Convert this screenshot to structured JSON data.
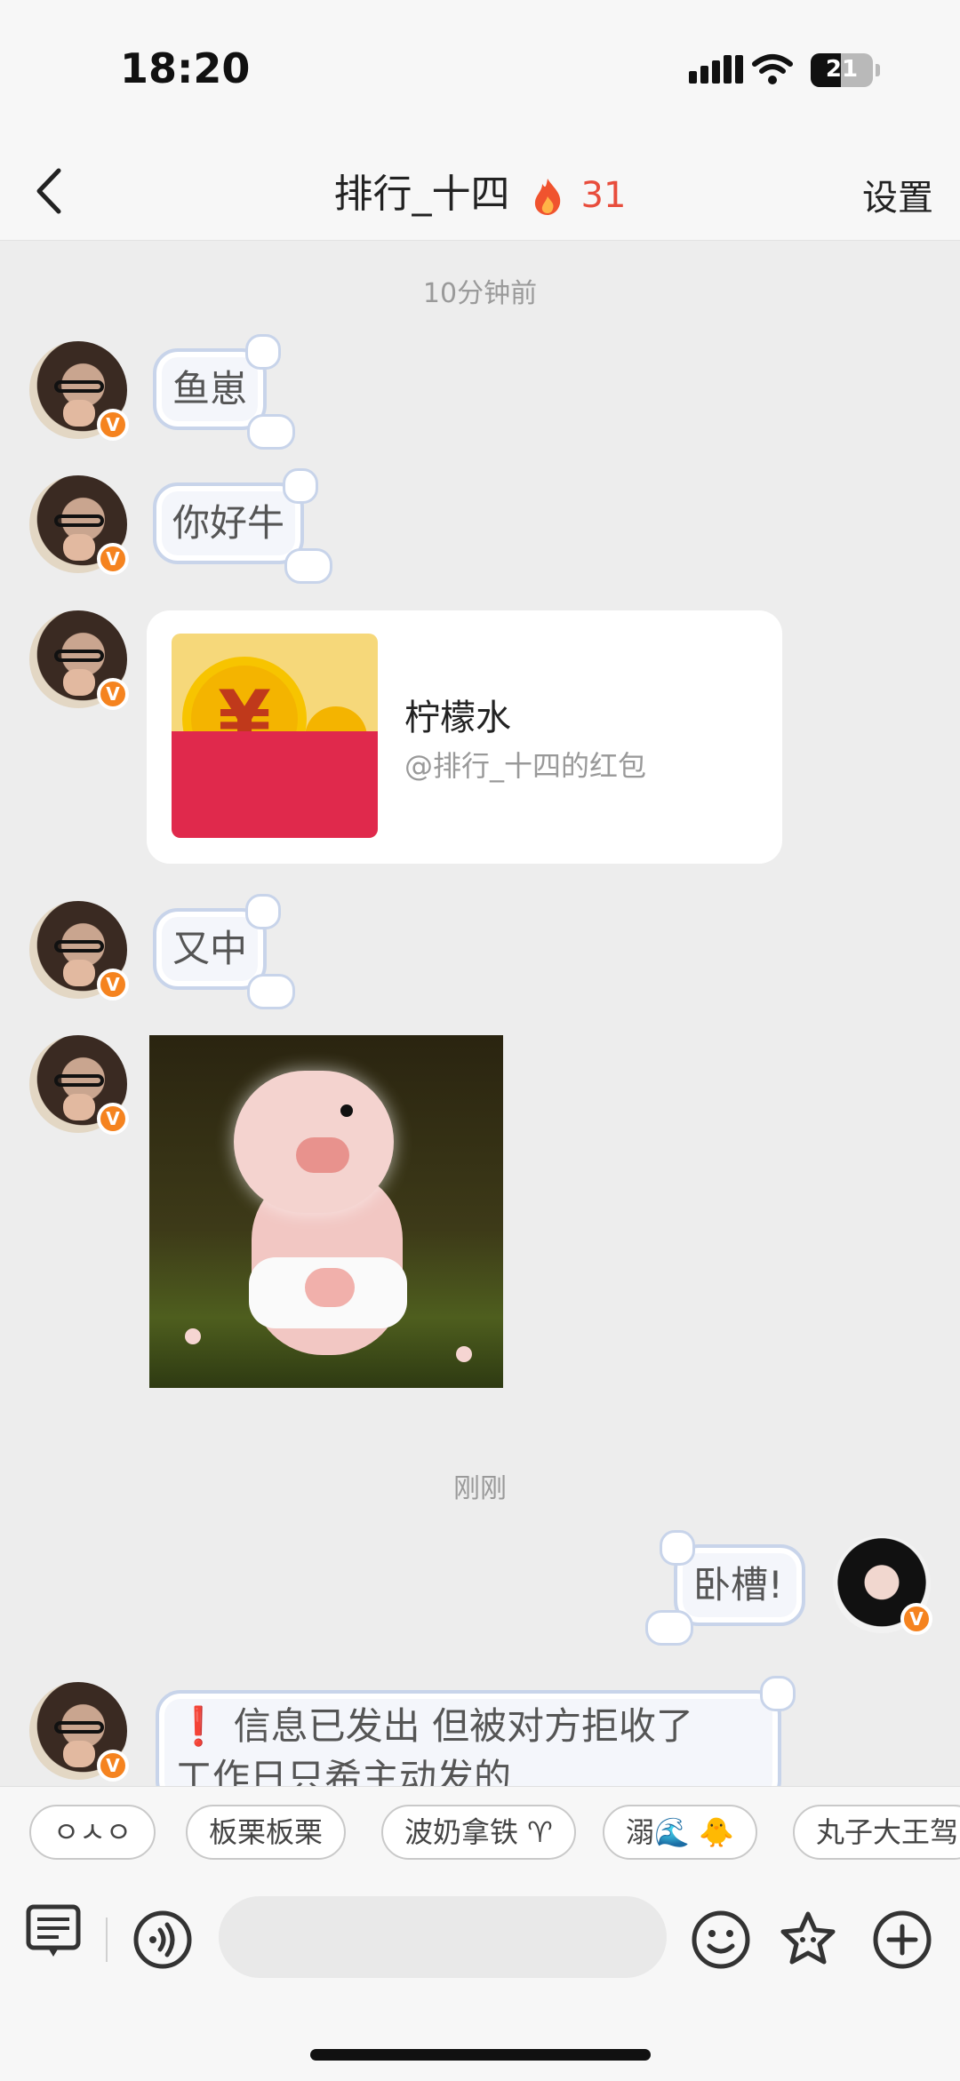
{
  "status_bar": {
    "time": "18:20",
    "battery": "21"
  },
  "nav": {
    "title": "排行_十四",
    "streak": "31",
    "settings_label": "设置"
  },
  "messages": {
    "timestamp_1": "10分钟前",
    "bubble_1": "鱼崽",
    "bubble_2": "你好牛",
    "red_packet": {
      "title": "柠檬水",
      "subtitle": "@排行_十四的红包",
      "symbol": "¥"
    },
    "bubble_3": "又中",
    "timestamp_2": "刚刚",
    "bubble_me": "卧槽!",
    "bubble_last_line1": "❗ 信息已发出 但被对方拒收了",
    "bubble_last_line2": "工作日只希主动发的"
  },
  "quick_replies": [
    "ㅇㅅㅇ",
    "板栗板栗",
    "波奶拿铁 ♈",
    "溺🌊 🐥",
    "丸子大王驾"
  ],
  "icons": {
    "back": "chevron-left-icon",
    "streak": "flame-icon",
    "notes": "notes-icon",
    "voice": "voice-icon",
    "emoji": "smile-icon",
    "sticker": "star-sticker-icon",
    "plus": "plus-icon"
  },
  "colors": {
    "accent": "#e84d3c",
    "badge": "#f5831f",
    "red_packet": "#e0294c",
    "bubble_border": "#c8d4ea"
  }
}
